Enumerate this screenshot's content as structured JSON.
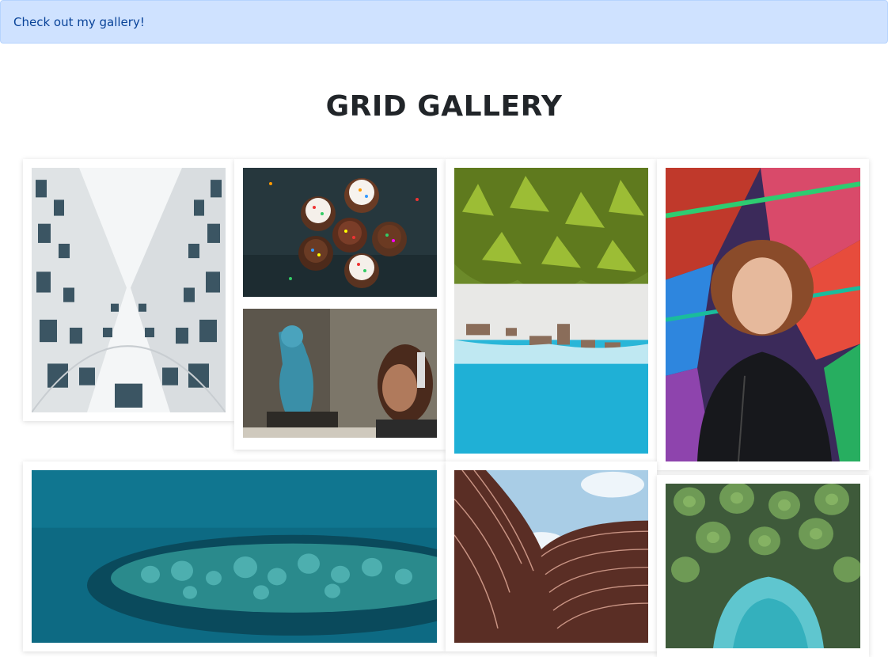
{
  "alert": {
    "text": "Check out my gallery!"
  },
  "gallery": {
    "title": "GRID GALLERY",
    "images": [
      {
        "subject": "looking up between two white apartment towers"
      },
      {
        "subject": "cupcakes with frosting and sprinkles on dark table"
      },
      {
        "subject": "graffiti wall and woman with headphones"
      },
      {
        "subject": "aerial view of palm trees, beach and turquoise sea"
      },
      {
        "subject": "young person in front of colorful graffiti"
      },
      {
        "subject": "aerial view of reef in deep teal water"
      },
      {
        "subject": "curved modern building facade against sky"
      },
      {
        "subject": "aerial view of palm trees over turquoise water"
      }
    ]
  },
  "colors": {
    "alert_bg": "#cfe2ff",
    "alert_text": "#084298",
    "title_text": "#212529"
  }
}
